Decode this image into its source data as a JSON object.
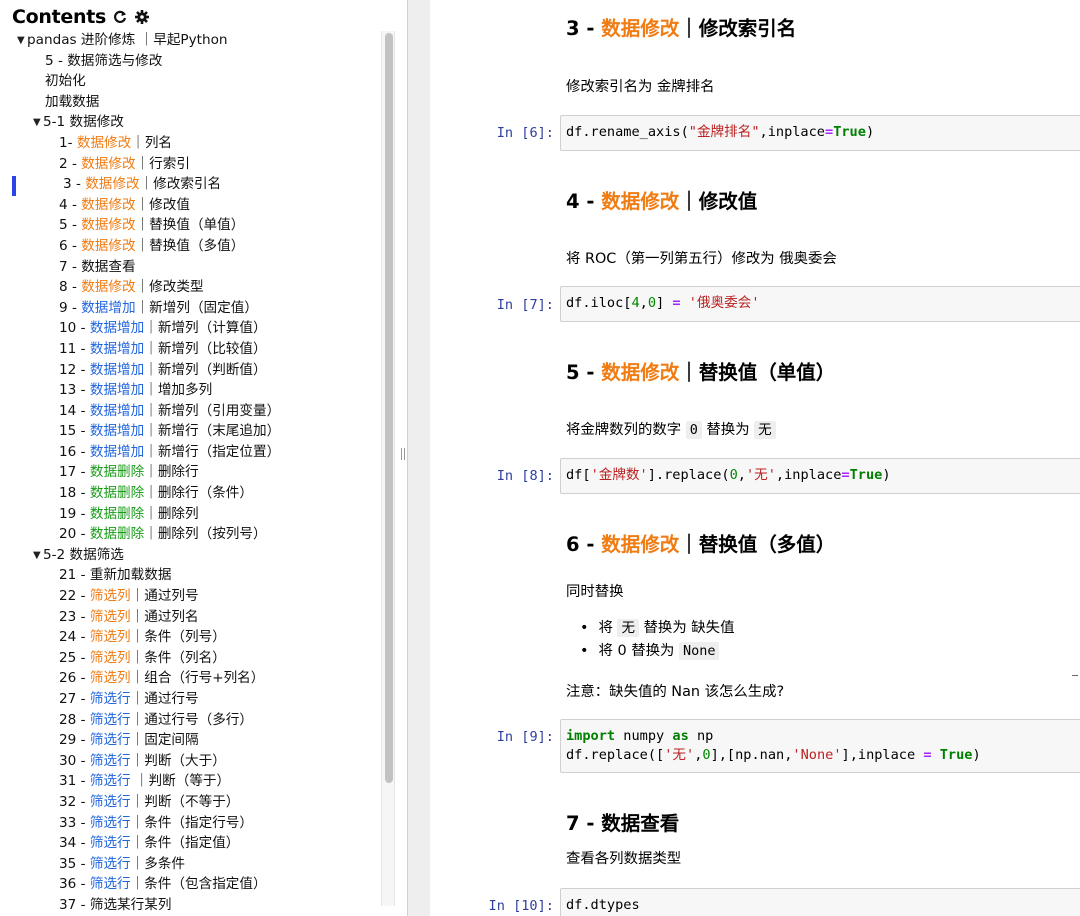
{
  "sidebar": {
    "title": "Contents",
    "refresh_icon": "refresh-icon",
    "settings_icon": "gear-icon",
    "items": [
      {
        "parts": [
          {
            "t": "pandas 进阶修炼 ｜早起Python"
          }
        ],
        "lvl": "lvl0",
        "caret": "▼"
      },
      {
        "parts": [
          {
            "t": "5 - 数据筛选与修改"
          }
        ],
        "lvl": "lvl1"
      },
      {
        "parts": [
          {
            "t": "初始化"
          }
        ],
        "lvl": "lvl1"
      },
      {
        "parts": [
          {
            "t": "加载数据"
          }
        ],
        "lvl": "lvl1"
      },
      {
        "parts": [
          {
            "t": "5-1 数据修改"
          }
        ],
        "lvl": "lvl1c",
        "caret": "▼"
      },
      {
        "parts": [
          {
            "t": "1- "
          },
          {
            "t": "数据修改",
            "c": "c-orange"
          },
          {
            "t": "｜列名"
          }
        ],
        "lvl": "lvl2"
      },
      {
        "parts": [
          {
            "t": "2 - "
          },
          {
            "t": "数据修改",
            "c": "c-orange"
          },
          {
            "t": "｜行索引"
          }
        ],
        "lvl": "lvl2"
      },
      {
        "parts": [
          {
            "t": "3 - "
          },
          {
            "t": "数据修改",
            "c": "c-orange"
          },
          {
            "t": "｜修改索引名"
          }
        ],
        "lvl": "lvl2a"
      },
      {
        "parts": [
          {
            "t": "4 - "
          },
          {
            "t": "数据修改",
            "c": "c-orange"
          },
          {
            "t": "｜修改值"
          }
        ],
        "lvl": "lvl2"
      },
      {
        "parts": [
          {
            "t": "5 - "
          },
          {
            "t": "数据修改",
            "c": "c-orange"
          },
          {
            "t": "｜替换值（单值）"
          }
        ],
        "lvl": "lvl2"
      },
      {
        "parts": [
          {
            "t": "6 - "
          },
          {
            "t": "数据修改",
            "c": "c-orange"
          },
          {
            "t": "｜替换值（多值）"
          }
        ],
        "lvl": "lvl2"
      },
      {
        "parts": [
          {
            "t": "7 - 数据查看"
          }
        ],
        "lvl": "lvl2"
      },
      {
        "parts": [
          {
            "t": "8 - "
          },
          {
            "t": "数据修改",
            "c": "c-orange"
          },
          {
            "t": "｜修改类型"
          }
        ],
        "lvl": "lvl2"
      },
      {
        "parts": [
          {
            "t": "9 - "
          },
          {
            "t": "数据增加",
            "c": "c-blue"
          },
          {
            "t": "｜新增列（固定值）"
          }
        ],
        "lvl": "lvl2"
      },
      {
        "parts": [
          {
            "t": "10 - "
          },
          {
            "t": "数据增加",
            "c": "c-blue"
          },
          {
            "t": "｜新增列（计算值）"
          }
        ],
        "lvl": "lvl2"
      },
      {
        "parts": [
          {
            "t": "11 - "
          },
          {
            "t": "数据增加",
            "c": "c-blue"
          },
          {
            "t": "｜新增列（比较值）"
          }
        ],
        "lvl": "lvl2"
      },
      {
        "parts": [
          {
            "t": "12 - "
          },
          {
            "t": "数据增加",
            "c": "c-blue"
          },
          {
            "t": "｜新增列（判断值）"
          }
        ],
        "lvl": "lvl2"
      },
      {
        "parts": [
          {
            "t": "13 - "
          },
          {
            "t": "数据增加",
            "c": "c-blue"
          },
          {
            "t": "｜增加多列"
          }
        ],
        "lvl": "lvl2"
      },
      {
        "parts": [
          {
            "t": "14 - "
          },
          {
            "t": "数据增加",
            "c": "c-blue"
          },
          {
            "t": "｜新增列（引用变量）"
          }
        ],
        "lvl": "lvl2"
      },
      {
        "parts": [
          {
            "t": "15 - "
          },
          {
            "t": "数据增加",
            "c": "c-blue"
          },
          {
            "t": "｜新增行（末尾追加）"
          }
        ],
        "lvl": "lvl2"
      },
      {
        "parts": [
          {
            "t": "16 - "
          },
          {
            "t": "数据增加",
            "c": "c-blue"
          },
          {
            "t": "｜新增行（指定位置）"
          }
        ],
        "lvl": "lvl2"
      },
      {
        "parts": [
          {
            "t": "17 - "
          },
          {
            "t": "数据删除",
            "c": "c-green"
          },
          {
            "t": "｜删除行"
          }
        ],
        "lvl": "lvl2"
      },
      {
        "parts": [
          {
            "t": "18 - "
          },
          {
            "t": "数据删除",
            "c": "c-green"
          },
          {
            "t": "｜删除行（条件）"
          }
        ],
        "lvl": "lvl2"
      },
      {
        "parts": [
          {
            "t": "19 - "
          },
          {
            "t": "数据删除",
            "c": "c-green"
          },
          {
            "t": "｜删除列"
          }
        ],
        "lvl": "lvl2"
      },
      {
        "parts": [
          {
            "t": "20 - "
          },
          {
            "t": "数据删除",
            "c": "c-green"
          },
          {
            "t": "｜删除列（按列号）"
          }
        ],
        "lvl": "lvl2"
      },
      {
        "parts": [
          {
            "t": "5-2 数据筛选"
          }
        ],
        "lvl": "lvl1c",
        "caret": "▼"
      },
      {
        "parts": [
          {
            "t": "21 - 重新加载数据"
          }
        ],
        "lvl": "lvl2"
      },
      {
        "parts": [
          {
            "t": "22 - "
          },
          {
            "t": "筛选列",
            "c": "c-orange"
          },
          {
            "t": "｜通过列号"
          }
        ],
        "lvl": "lvl2"
      },
      {
        "parts": [
          {
            "t": "23 - "
          },
          {
            "t": "筛选列",
            "c": "c-orange"
          },
          {
            "t": "｜通过列名"
          }
        ],
        "lvl": "lvl2"
      },
      {
        "parts": [
          {
            "t": "24 - "
          },
          {
            "t": "筛选列",
            "c": "c-orange"
          },
          {
            "t": "｜条件（列号）"
          }
        ],
        "lvl": "lvl2"
      },
      {
        "parts": [
          {
            "t": "25 - "
          },
          {
            "t": "筛选列",
            "c": "c-orange"
          },
          {
            "t": "｜条件（列名）"
          }
        ],
        "lvl": "lvl2"
      },
      {
        "parts": [
          {
            "t": "26 - "
          },
          {
            "t": "筛选列",
            "c": "c-orange"
          },
          {
            "t": "｜组合（行号+列名）"
          }
        ],
        "lvl": "lvl2"
      },
      {
        "parts": [
          {
            "t": "27 - "
          },
          {
            "t": "筛选行",
            "c": "c-blue"
          },
          {
            "t": "｜通过行号"
          }
        ],
        "lvl": "lvl2"
      },
      {
        "parts": [
          {
            "t": "28 - "
          },
          {
            "t": "筛选行",
            "c": "c-blue"
          },
          {
            "t": "｜通过行号（多行）"
          }
        ],
        "lvl": "lvl2"
      },
      {
        "parts": [
          {
            "t": "29 - "
          },
          {
            "t": "筛选行",
            "c": "c-blue"
          },
          {
            "t": "｜固定间隔"
          }
        ],
        "lvl": "lvl2"
      },
      {
        "parts": [
          {
            "t": "30 - "
          },
          {
            "t": "筛选行",
            "c": "c-blue"
          },
          {
            "t": "｜判断（大于）"
          }
        ],
        "lvl": "lvl2"
      },
      {
        "parts": [
          {
            "t": "31 - "
          },
          {
            "t": "筛选行",
            "c": "c-blue"
          },
          {
            "t": " ｜判断（等于）"
          }
        ],
        "lvl": "lvl2"
      },
      {
        "parts": [
          {
            "t": "32 - "
          },
          {
            "t": "筛选行",
            "c": "c-blue"
          },
          {
            "t": "｜判断（不等于）"
          }
        ],
        "lvl": "lvl2"
      },
      {
        "parts": [
          {
            "t": "33 - "
          },
          {
            "t": "筛选行",
            "c": "c-blue"
          },
          {
            "t": "｜条件（指定行号）"
          }
        ],
        "lvl": "lvl2"
      },
      {
        "parts": [
          {
            "t": "34 - "
          },
          {
            "t": "筛选行",
            "c": "c-blue"
          },
          {
            "t": "｜条件（指定值）"
          }
        ],
        "lvl": "lvl2"
      },
      {
        "parts": [
          {
            "t": "35 - "
          },
          {
            "t": "筛选行",
            "c": "c-blue"
          },
          {
            "t": "｜多条件"
          }
        ],
        "lvl": "lvl2"
      },
      {
        "parts": [
          {
            "t": "36 - "
          },
          {
            "t": "筛选行",
            "c": "c-blue"
          },
          {
            "t": "｜条件（包含指定值）"
          }
        ],
        "lvl": "lvl2"
      },
      {
        "parts": [
          {
            "t": "37 - 筛选某行某列"
          }
        ],
        "lvl": "lvl2"
      }
    ]
  },
  "notebook": {
    "h3_a": {
      "num": "3 - ",
      "tag": "数据修改",
      "rest": "｜修改索引名"
    },
    "md_a": "修改索引名为 金牌排名",
    "prompt6": "In [6]:",
    "h3_b": {
      "num": "4 - ",
      "tag": "数据修改",
      "rest": "｜修改值"
    },
    "md_b": "将 ROC（第一列第五行）修改为 俄奥委会",
    "prompt7": "In [7]:",
    "h3_c": {
      "num": "5 - ",
      "tag": "数据修改",
      "rest": "｜替换值（单值）"
    },
    "md_c": {
      "pre": "将金牌数列的数字 ",
      "code1": "0",
      "mid": " 替换为 ",
      "code2": "无"
    },
    "prompt8": "In [8]:",
    "h3_d": {
      "num": "6 - ",
      "tag": "数据修改",
      "rest": "｜替换值（多值）"
    },
    "md_d": "同时替换",
    "bullet1": {
      "pre": "将 ",
      "code": "无",
      "post": " 替换为 缺失值"
    },
    "bullet2": {
      "pre": "将 0 替换为 ",
      "code": "None"
    },
    "md_e": "注意：缺失值的 Nan 该怎么生成?",
    "prompt9": "In [9]:",
    "h3_e": "7 - 数据查看",
    "md_f": "查看各列数据类型",
    "prompt10": "In [10]:",
    "code": {
      "c6_a": "df.rename_axis(",
      "c6_s": "\"金牌排名\"",
      "c6_b": ",inplace",
      "c6_eq": "=",
      "c6_k": "True",
      "c6_c": ")",
      "c7_a": "df.iloc[",
      "c7_n1": "4",
      "c7_b": ",",
      "c7_n2": "0",
      "c7_c": "] ",
      "c7_eq": "=",
      "c7_d": " ",
      "c7_s": "'俄奥委会'",
      "c8_a": "df[",
      "c8_s1": "'金牌数'",
      "c8_b": "].replace(",
      "c8_n": "0",
      "c8_c": ",",
      "c8_s2": "'无'",
      "c8_d": ",inplace",
      "c8_eq": "=",
      "c8_k": "True",
      "c8_e": ")",
      "c9_k1": "import",
      "c9_a": " numpy ",
      "c9_k2": "as",
      "c9_b": " np",
      "c9_c": "df.replace([",
      "c9_s1": "'无'",
      "c9_d": ",",
      "c9_n": "0",
      "c9_e": "],[np.nan,",
      "c9_s2": "'None'",
      "c9_f": "],inplace ",
      "c9_eq": "=",
      "c9_g": " ",
      "c9_k3": "True",
      "c9_h": ")",
      "c10": "df.dtypes"
    }
  }
}
